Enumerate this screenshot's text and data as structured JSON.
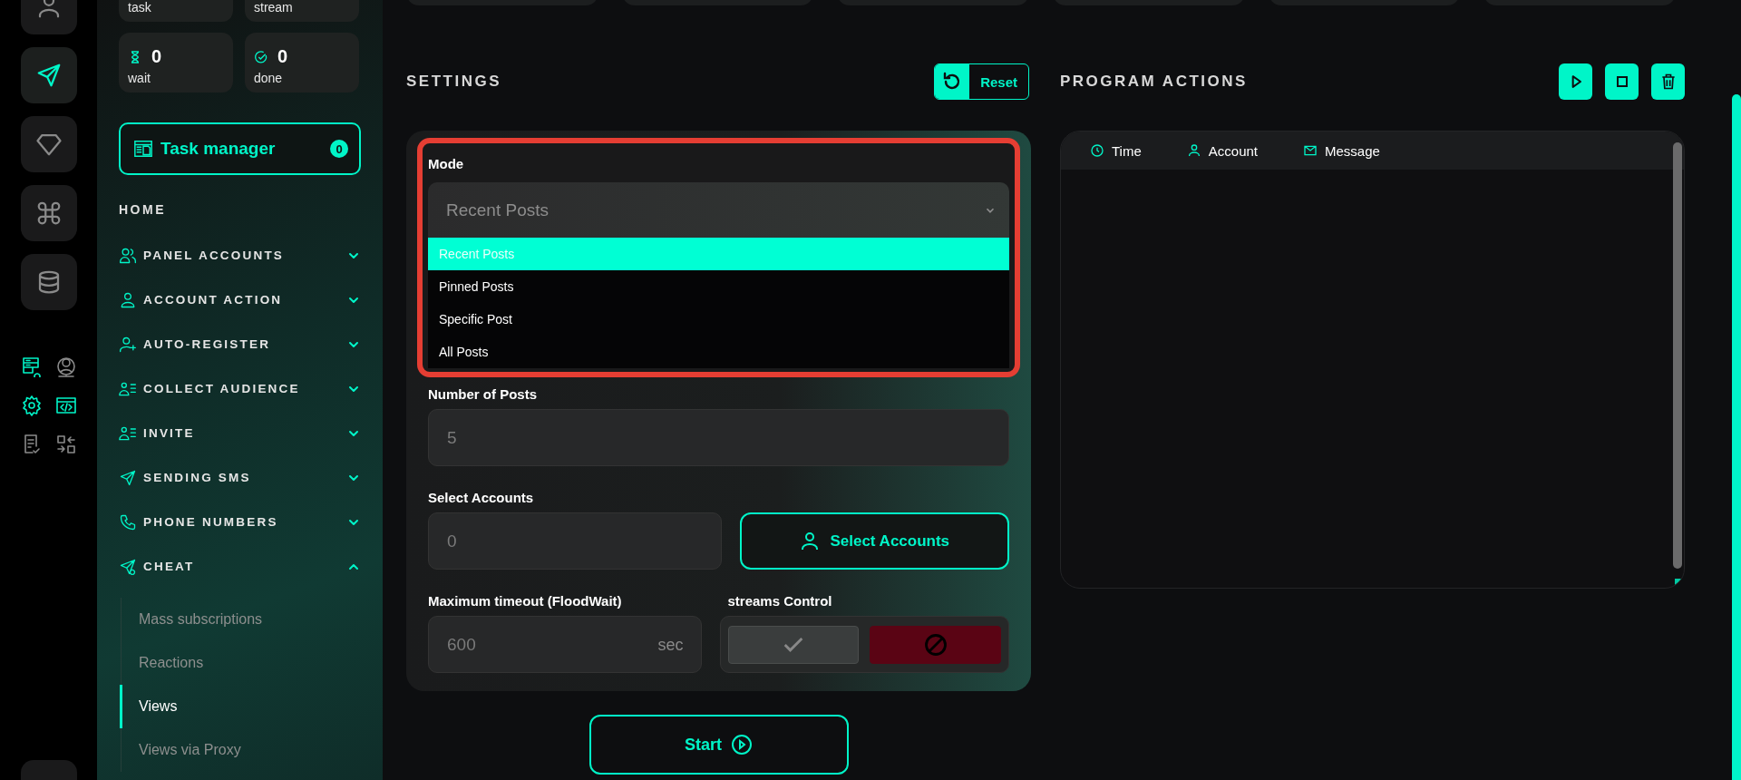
{
  "rail": {
    "items": [
      {
        "selected": false
      },
      {
        "selected": true
      },
      {
        "selected": false
      },
      {
        "selected": false
      },
      {
        "selected": false
      }
    ],
    "tools": [
      {
        "active": true
      },
      {
        "active": false
      },
      {
        "active": true
      },
      {
        "active": true
      },
      {
        "active": false
      },
      {
        "active": false
      }
    ]
  },
  "stats": [
    {
      "label": "task"
    },
    {
      "label": "stream"
    },
    {
      "value": "0",
      "label": "wait"
    },
    {
      "value": "0",
      "label": "done"
    }
  ],
  "task_manager": {
    "label": "Task manager",
    "count": "0"
  },
  "nav": {
    "heading": "HOME",
    "items": [
      {
        "label": "PANEL ACCOUNTS",
        "expanded": false
      },
      {
        "label": "ACCOUNT ACTION",
        "expanded": false
      },
      {
        "label": "AUTO-REGISTER",
        "expanded": false
      },
      {
        "label": "COLLECT AUDIENCE",
        "expanded": false
      },
      {
        "label": "INVITE",
        "expanded": false
      },
      {
        "label": "SENDING SMS",
        "expanded": false
      },
      {
        "label": "PHONE NUMBERS",
        "expanded": false
      },
      {
        "label": "CHEAT",
        "expanded": true,
        "children": [
          {
            "label": "Mass subscriptions",
            "selected": false
          },
          {
            "label": "Reactions",
            "selected": false
          },
          {
            "label": "Views",
            "selected": true
          },
          {
            "label": "Views via Proxy",
            "selected": false
          }
        ]
      }
    ]
  },
  "settings": {
    "title": "SETTINGS",
    "reset": "Reset",
    "mode": {
      "label": "Mode",
      "value": "Recent Posts",
      "options": [
        {
          "label": "Recent Posts",
          "selected": true
        },
        {
          "label": "Pinned Posts",
          "selected": false
        },
        {
          "label": "Specific Post",
          "selected": false
        },
        {
          "label": "All Posts",
          "selected": false
        }
      ]
    },
    "posts": {
      "label": "Number of Posts",
      "placeholder": "5"
    },
    "accounts": {
      "label": "Select Accounts",
      "placeholder": "0",
      "button": "Select Accounts"
    },
    "timeout": {
      "label": "Maximum timeout (FloodWait)",
      "placeholder": "600",
      "unit": "sec"
    },
    "streams": {
      "label": "streams Control",
      "enabled": false
    },
    "start": "Start"
  },
  "actions": {
    "title": "PROGRAM ACTIONS",
    "columns": [
      "Time",
      "Account",
      "Message"
    ]
  }
}
